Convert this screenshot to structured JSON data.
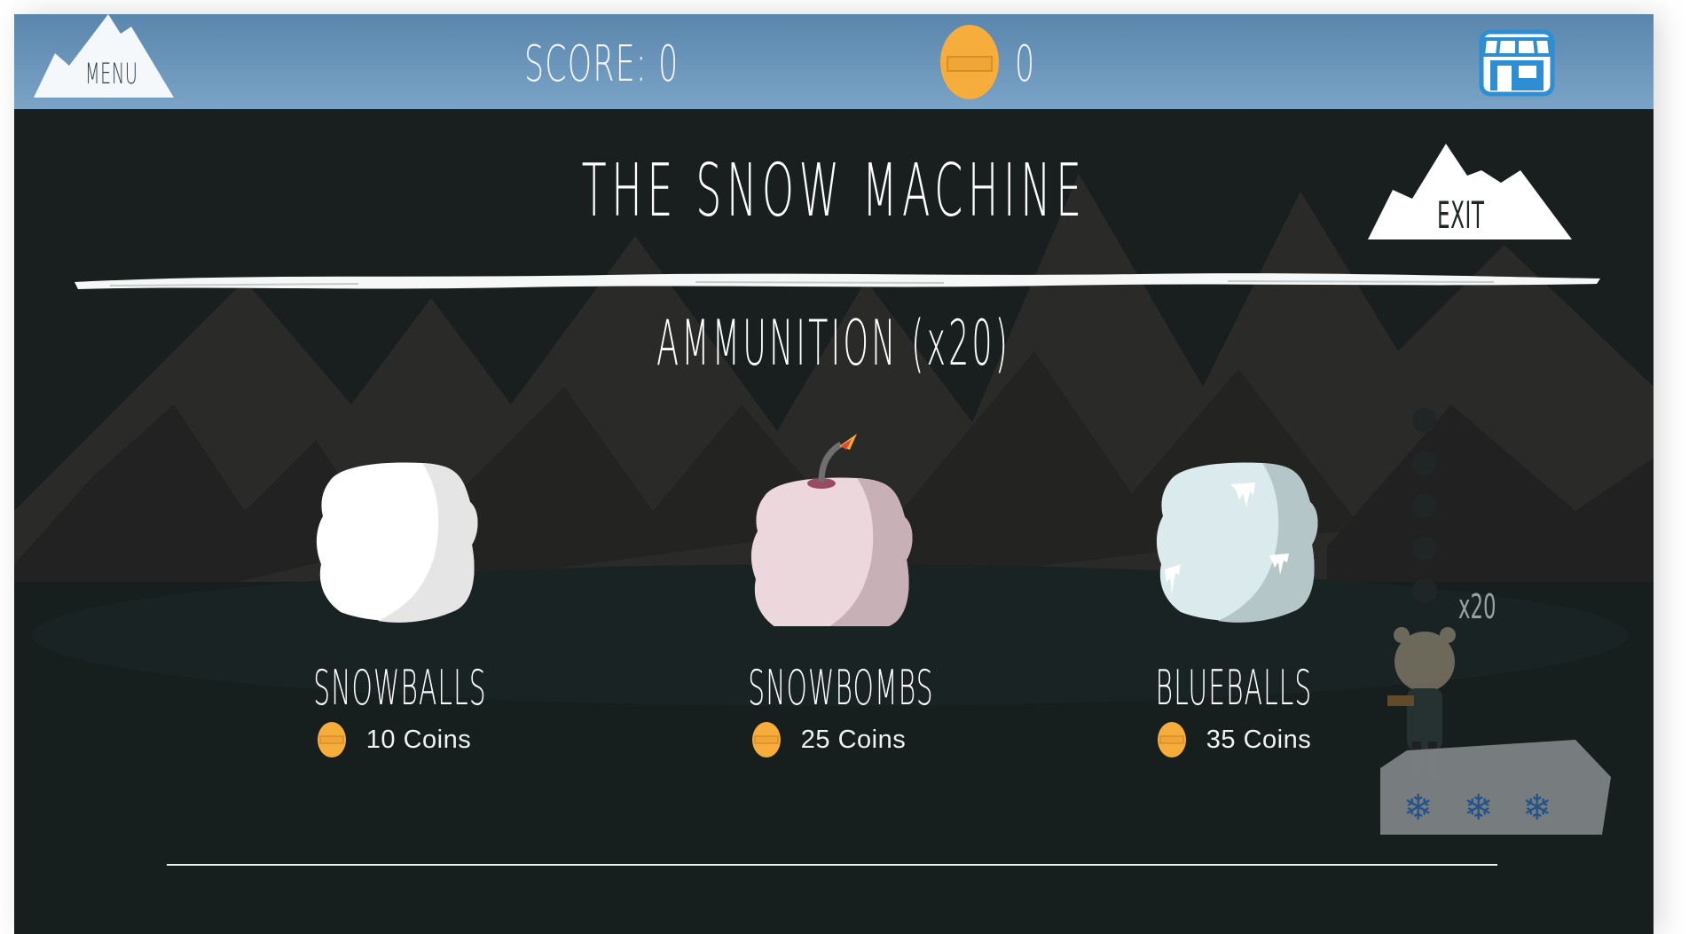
{
  "header": {
    "menu_label": "MENU",
    "score_text": "SCORE: 0",
    "coins_value": "0"
  },
  "shop": {
    "title": "THE SNOW MACHINE",
    "exit_label": "EXIT",
    "section_title": "AMMUNITION (x20)",
    "items": [
      {
        "name": "SNOWBALLS",
        "price": "10 Coins",
        "color": "#ffffff"
      },
      {
        "name": "SNOWBOMBS",
        "price": "25 Coins",
        "color": "#e9d3d8"
      },
      {
        "name": "BLUEBALLS",
        "price": "35 Coins",
        "color": "#d8e8ea"
      }
    ]
  },
  "side_panel": {
    "ammo_count": "x20"
  },
  "colors": {
    "topbar": "#6b96bb",
    "background": "#1f2626",
    "coin": "#f6ad3c"
  }
}
